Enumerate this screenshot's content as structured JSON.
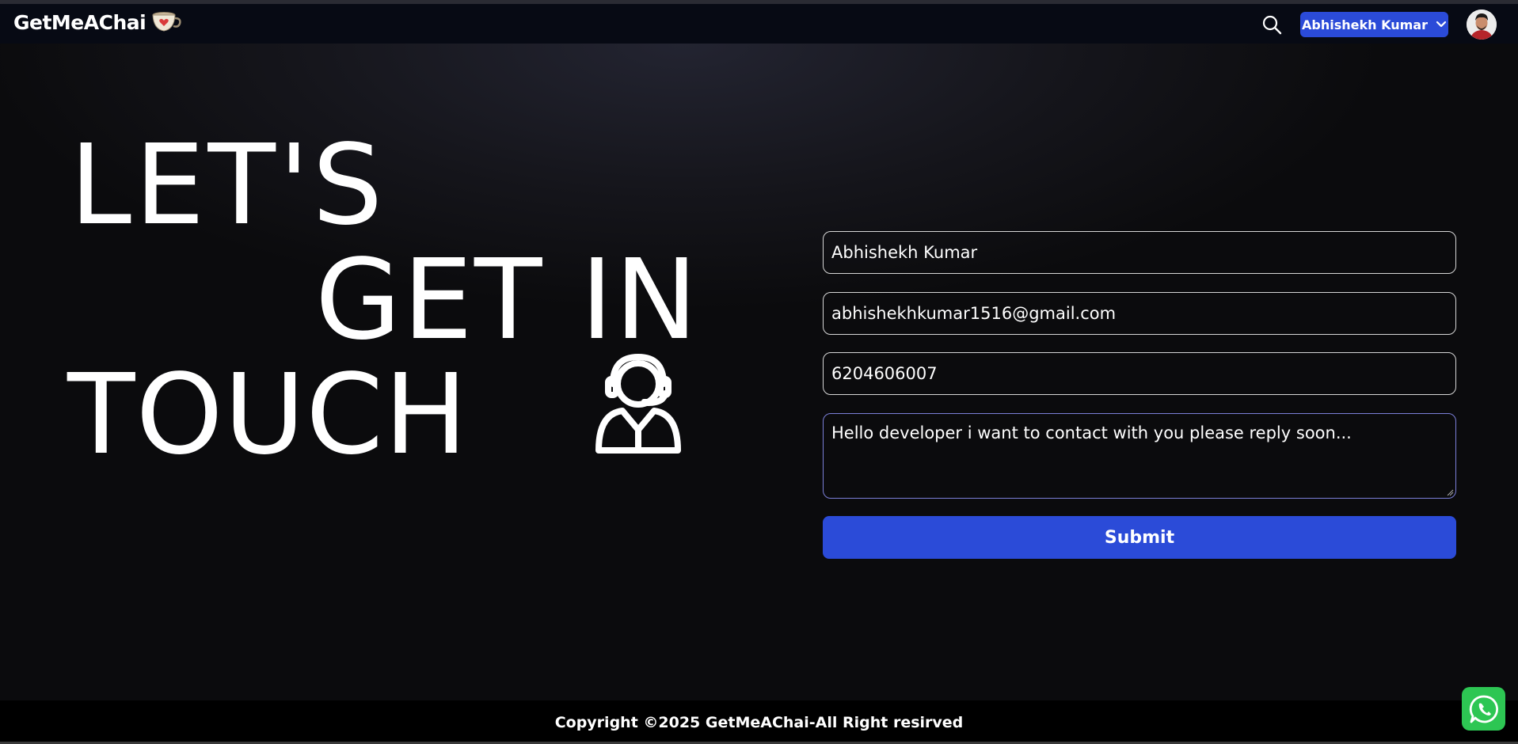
{
  "navbar": {
    "brand": "GetMeAChai",
    "brand_icon": "chai-cup-heart-icon",
    "search_icon": "search-icon",
    "user_menu_label": "Abhishekh Kumar",
    "user_menu_icon": "chevron-down-icon",
    "avatar": "avatar"
  },
  "hero": {
    "line1": "LET'S",
    "line2": "GET IN",
    "line3": "TOUCH",
    "icon": "customer-support-icon"
  },
  "form": {
    "name_value": "Abhishekh Kumar",
    "email_value": "abhishekhkumar1516@gmail.com",
    "phone_value": "6204606007",
    "message_value": "Hello developer i want to contact with you please reply soon...",
    "submit_label": "Submit"
  },
  "footer": {
    "text": "Copyright ©2025 GetMeAChai-All Right resirved"
  },
  "floating": {
    "whatsapp_icon": "whatsapp-icon"
  },
  "colors": {
    "accent": "#2b4bd8",
    "navbar_bg": "#070a14",
    "footer_bg": "#000000",
    "whatsapp": "#2dc653"
  }
}
